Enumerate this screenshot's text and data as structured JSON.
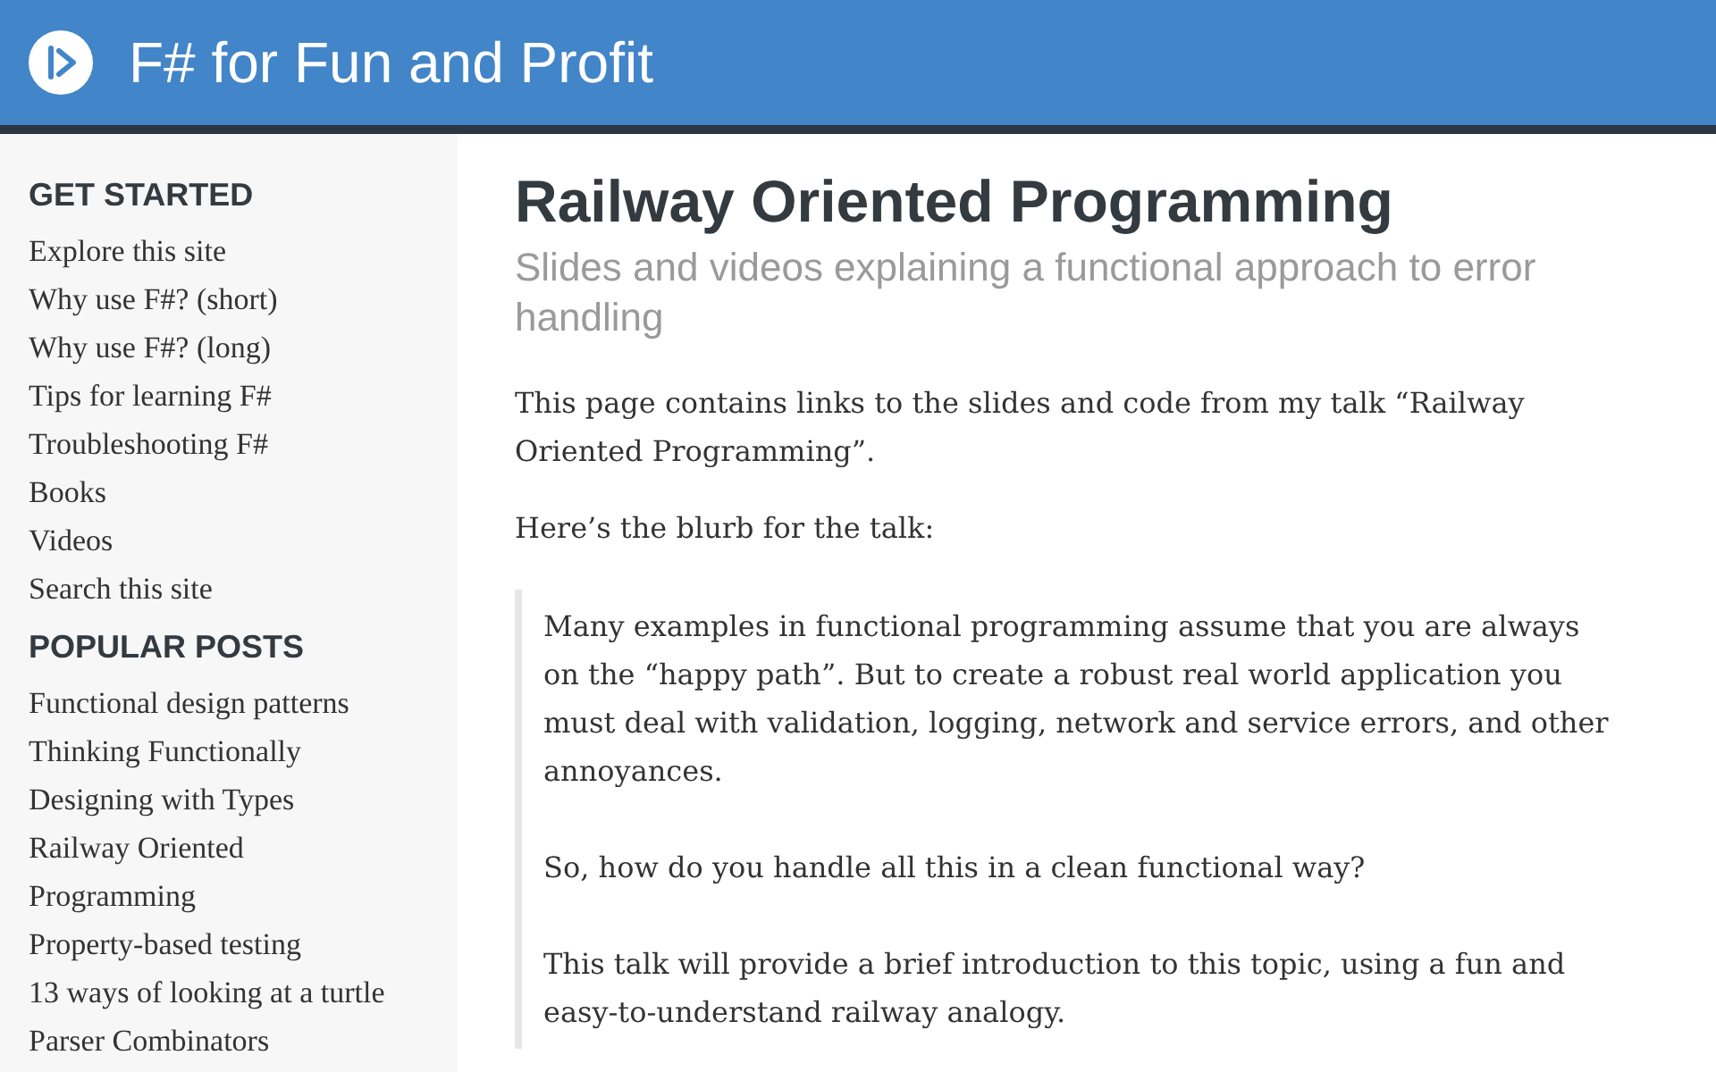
{
  "header": {
    "site_title": "F# for Fun and Profit"
  },
  "sidebar": {
    "sections": [
      {
        "heading": "GET STARTED",
        "items": [
          "Explore this site",
          "Why use F#? (short)",
          "Why use F#? (long)",
          "Tips for learning F#",
          "Troubleshooting F#",
          "Books",
          "Videos",
          "Search this site"
        ]
      },
      {
        "heading": "POPULAR POSTS",
        "items": [
          "Functional design patterns",
          "Thinking Functionally",
          "Designing with Types",
          "Railway Oriented Programming",
          "Property-based testing",
          "13 ways of looking at a turtle",
          "Parser Combinators"
        ]
      }
    ]
  },
  "article": {
    "title": "Railway Oriented Programming",
    "subtitle": "Slides and videos explaining a functional approach to error handling",
    "paragraphs": [
      "This page contains links to the slides and code from my talk “Railway Oriented Programming”.",
      "Here’s the blurb for the talk:"
    ],
    "blockquote": [
      "Many examples in functional programming assume that you are always on the “happy path”. But to create a robust real world application you must deal with validation, logging, network and service errors, and other annoyances.",
      "So, how do you handle all this in a clean functional way?",
      "This talk will provide a brief introduction to this topic, using a fun and easy-to-understand railway analogy."
    ]
  }
}
